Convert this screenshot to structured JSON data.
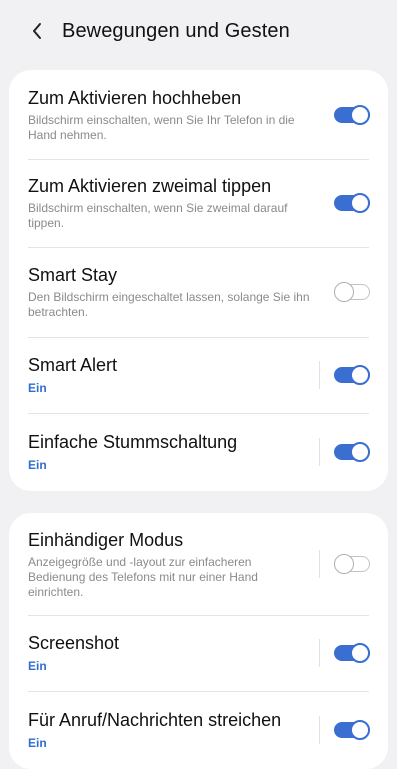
{
  "header": {
    "back_icon": "chevron-left-icon",
    "title": "Bewegungen und Gesten"
  },
  "colors": {
    "accent": "#3a6fd1",
    "status_text": "#2f6ed1",
    "background": "#f1f1f3",
    "card": "#ffffff"
  },
  "groups": [
    {
      "items": [
        {
          "title": "Zum Aktivieren hochheben",
          "description": "Bildschirm einschalten, wenn Sie Ihr Telefon in die Hand nehmen.",
          "toggle_on": true
        },
        {
          "title": "Zum Aktivieren zweimal tippen",
          "description": "Bildschirm einschalten, wenn Sie zweimal darauf tippen.",
          "toggle_on": true
        },
        {
          "title": "Smart Stay",
          "description": "Den Bildschirm eingeschaltet lassen, solange Sie ihn betrachten.",
          "toggle_on": false
        },
        {
          "title": "Smart Alert",
          "status": "Ein",
          "toggle_on": true
        },
        {
          "title": "Einfache Stummschaltung",
          "status": "Ein",
          "toggle_on": true
        }
      ]
    },
    {
      "items": [
        {
          "title": "Einhändiger Modus",
          "description": "Anzeigegröße und -layout zur einfacheren Bedienung des Telefons mit nur einer Hand einrichten.",
          "toggle_on": false
        },
        {
          "title": "Screenshot",
          "status": "Ein",
          "toggle_on": true
        },
        {
          "title": "Für Anruf/Nachrichten streichen",
          "status": "Ein",
          "toggle_on": true
        }
      ]
    }
  ]
}
